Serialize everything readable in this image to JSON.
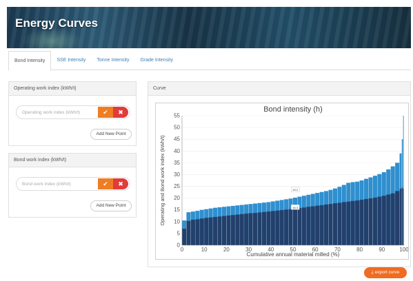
{
  "header": {
    "title": "Energy Curves"
  },
  "tabs": [
    {
      "label": "Bond Intensity",
      "active": true
    },
    {
      "label": "SSE Intensity",
      "active": false
    },
    {
      "label": "Tonne Intensity",
      "active": false
    },
    {
      "label": "Grade Intensity",
      "active": false
    }
  ],
  "operating_panel": {
    "title": "Operating work index (kWh/t)",
    "placeholder": "Operating work index (kWh/t)",
    "value": "",
    "add_label": "Add New Point"
  },
  "bond_panel": {
    "title": "Bond work index (kWh/t)",
    "placeholder": "Bond work index (kWh/t)",
    "value": "",
    "add_label": "Add New Point"
  },
  "curve_panel": {
    "title": "Curve"
  },
  "icons": {
    "confirm": "check-icon",
    "delete": "close-icon",
    "download": "download-icon"
  },
  "export_label": "export curve",
  "colors": {
    "accent": "#ef7d22",
    "danger": "#e23b3b",
    "upper_series": "#2f8fcf",
    "lower_series": "#22406b",
    "link": "#3a7fb7"
  },
  "chart_data": {
    "type": "bar",
    "title": "Bond intensity (h)",
    "xlabel": "Cumulative annual material milled (%)",
    "ylabel": "Operating and Bond work index (kWh/t)",
    "xlim": [
      0,
      100
    ],
    "ylim": [
      0,
      55
    ],
    "xticks": [
      0,
      10,
      20,
      30,
      40,
      50,
      60,
      70,
      80,
      90,
      100
    ],
    "yticks": [
      0,
      5,
      10,
      15,
      20,
      25,
      30,
      35,
      40,
      45,
      50,
      55
    ],
    "grid": true,
    "series": [
      {
        "name": "",
        "color": "#2f8fcf",
        "x": [
          0,
          2,
          4,
          6,
          8,
          10,
          12,
          14,
          16,
          18,
          20,
          22,
          24,
          26,
          28,
          30,
          32,
          34,
          36,
          38,
          40,
          42,
          44,
          46,
          48,
          50,
          52,
          54,
          56,
          58,
          60,
          62,
          64,
          66,
          68,
          70,
          72,
          74,
          76,
          78,
          80,
          82,
          84,
          86,
          88,
          90,
          92,
          94,
          96,
          98,
          99,
          99.6
        ],
        "values": [
          10.5,
          14,
          14.3,
          14.6,
          15,
          15.3,
          15.6,
          15.9,
          16.1,
          16.3,
          16.5,
          16.7,
          16.9,
          17.1,
          17.3,
          17.5,
          17.7,
          17.9,
          18.1,
          18.3,
          18.6,
          18.9,
          19.2,
          19.5,
          19.8,
          20.2,
          20.6,
          21,
          21.4,
          21.8,
          22.2,
          22.6,
          23,
          23.5,
          24.1,
          24.8,
          25.6,
          26.5,
          26.8,
          27,
          27.5,
          28.2,
          28.8,
          29.5,
          30.2,
          31,
          32.2,
          33.5,
          35,
          39,
          45,
          55
        ]
      },
      {
        "name": "",
        "color": "#22406b",
        "x": [
          0,
          2,
          4,
          6,
          8,
          10,
          12,
          14,
          16,
          18,
          20,
          22,
          24,
          26,
          28,
          30,
          32,
          34,
          36,
          38,
          40,
          42,
          44,
          46,
          48,
          50,
          52,
          54,
          56,
          58,
          60,
          62,
          64,
          66,
          68,
          70,
          72,
          74,
          76,
          78,
          80,
          82,
          84,
          86,
          88,
          90,
          92,
          94,
          96,
          98,
          99,
          99.6
        ],
        "values": [
          7,
          10.3,
          10.8,
          11,
          11.3,
          11.6,
          11.8,
          12,
          12.2,
          12.4,
          12.6,
          12.8,
          13,
          13.2,
          13.4,
          13.6,
          13.7,
          13.9,
          14.1,
          14.3,
          14.5,
          14.7,
          14.9,
          15.1,
          15.3,
          15.6,
          15.8,
          16,
          16.3,
          16.5,
          16.8,
          17,
          17.3,
          17.5,
          17.8,
          18,
          18.3,
          18.5,
          18.8,
          19,
          19.3,
          19.6,
          19.9,
          20.2,
          20.6,
          21,
          21.5,
          22,
          23,
          24,
          24.5,
          24
        ]
      }
    ],
    "annotations": [
      {
        "text": "19.2",
        "x": 51,
        "y": 23.5
      },
      {
        "text": "16.3",
        "x": 51,
        "y": 16
      }
    ]
  }
}
